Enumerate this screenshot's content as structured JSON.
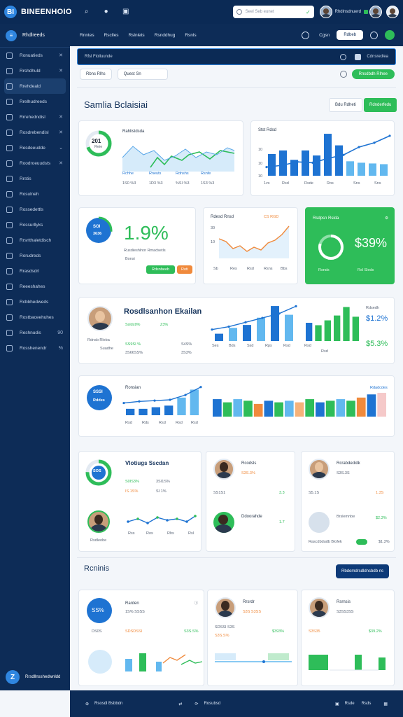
{
  "app": {
    "brand": "BINEENHOIO",
    "logo": "BI"
  },
  "topbar": {
    "search_placeholder": "Seel Seb eunet",
    "user_name": "Rhdlnsdnuerd"
  },
  "sidebar": {
    "title": "Rhdlreeds",
    "items": [
      {
        "label": "Ronuatieds",
        "icon": "grid-icon",
        "x": true
      },
      {
        "label": "Rrshdhuld",
        "icon": "list-icon",
        "x": true
      },
      {
        "label": "Rrehdeald",
        "icon": "home-icon",
        "active": true
      },
      {
        "label": "Rrelhudreeds",
        "icon": "chart-icon"
      },
      {
        "label": "Rrrehedndisl",
        "icon": "doc-icon",
        "x": true
      },
      {
        "label": "Rosdrebendisl",
        "icon": "doc-icon",
        "x": true
      },
      {
        "label": "Resdeeudde",
        "icon": "doc-icon",
        "chev": true
      },
      {
        "label": "Roodroeuudsts",
        "icon": "doc-icon",
        "x": true
      },
      {
        "label": "Rrstis",
        "icon": "bag-icon"
      },
      {
        "label": "Rosulneh",
        "icon": "bag-icon"
      },
      {
        "label": "Rossedettls",
        "icon": "bag-icon"
      },
      {
        "label": "Rossurllyks",
        "icon": "bag-icon"
      },
      {
        "label": "Rrsrtthaletdisch",
        "icon": "bag-icon"
      },
      {
        "label": "Rorudreds",
        "icon": "bag-icon"
      },
      {
        "label": "Rrasdsdrl",
        "icon": "bag-icon"
      },
      {
        "label": "Reeeshahes",
        "icon": "bag-icon"
      },
      {
        "label": "Rcbbhedweds",
        "icon": "bag-icon"
      },
      {
        "label": "Rostbaceehuhes",
        "icon": "bag-icon"
      },
      {
        "label": "Reshnudis",
        "icon": "bag-icon",
        "tag": "90"
      },
      {
        "label": "Rosshenendr",
        "icon": "bag-icon",
        "tag": "%"
      }
    ],
    "footer": "Rrsdllnsshedwnldd"
  },
  "tabs": [
    "Rnntes",
    "Rsclles",
    "Rslnlets",
    "Rsnddhug",
    "Rsnls"
  ],
  "tabbar": {
    "label": "Cgsn",
    "pill": "Rdbeb"
  },
  "subbar": {
    "label": "Rfsl Fiolluunde",
    "right": "Cdnsredlea"
  },
  "filters": [
    "Rbns Rlhs",
    "Quest Sn"
  ],
  "add_button": "Rnsdbdh Rlhee",
  "section": {
    "title": "Samlia Bclaisiai",
    "btn1": "Bdu Rdheti",
    "btn2": "Rdnderfedu"
  },
  "card1": {
    "ring": "201",
    "ring_sub": "Reie",
    "title": "Rahlistdsda",
    "labels": [
      "Rchhe",
      "Rneuts",
      "Rdnshs",
      "Rsnfe"
    ],
    "values": [
      "1S0 %3",
      "1D3 %3",
      "%SI %3",
      "1S3 %3"
    ]
  },
  "card2": {
    "title": "Stst Rdsd",
    "y": [
      "10",
      "10",
      "10"
    ],
    "bars": [
      30,
      35,
      22,
      35,
      28,
      58,
      42,
      20,
      18,
      17,
      16
    ],
    "line": [
      10,
      12,
      16,
      15,
      20,
      24,
      33,
      38,
      46
    ],
    "xlabels": [
      "1vs",
      "Rsd",
      "Rsde",
      "Ros",
      "Sns",
      "Sns"
    ]
  },
  "card3": {
    "ring": "SOI",
    "ring_sub": "3636",
    "big": "1.9%",
    "sub": "Rusdieshlnor Rmadsetls",
    "sub2": "Bonsi",
    "btn": "Rdsnbeeb",
    "btn2": "Roti"
  },
  "card4": {
    "title": "Rdesd Rnsd",
    "tag": "CS RGD",
    "y": [
      "30",
      "10"
    ],
    "line": [
      28,
      24,
      14,
      18,
      10,
      16,
      12,
      22,
      26,
      34,
      46
    ],
    "xlabels": [
      "Sb",
      "Res",
      "Rsd",
      "Rsns",
      "Bbs"
    ]
  },
  "card5": {
    "title": "Rsdpsn Rsida",
    "big": "$39%",
    "sub": "Rsnds",
    "sub2": "Rsl Sleds"
  },
  "card6": {
    "title": "Rosdlsanhon Ekailan",
    "name": "Rdnsb Rleba",
    "date": "Suadhe",
    "v1": "Sslds9%",
    "v2": "Z3%",
    "v3": "SS9SI %",
    "v4": "S4S%",
    "v5": "3S66SS%",
    "v6": "3S3%",
    "line": [
      8,
      12,
      18,
      24,
      30,
      40
    ],
    "bars": [
      10,
      18,
      22,
      32,
      48,
      36
    ],
    "right_label": "Rdsedh",
    "right_big": "$1.2%",
    "right_big2": "$5.3%",
    "xlabels": [
      "Ses",
      "Bds",
      "Ssd",
      "Rps",
      "Rsd",
      "Rsb"
    ],
    "gbars": [
      30,
      26,
      34,
      42,
      56,
      40
    ],
    "gxlabels": [
      "Rsd",
      "Rsd"
    ]
  },
  "card7": {
    "ring": "SSSI",
    "ring_sub": "Rddes",
    "title": "Ronsian",
    "right": "Rdadcdes",
    "line": [
      10,
      12,
      13,
      14,
      20,
      30
    ],
    "bars": [
      8,
      8,
      10,
      12,
      22,
      32
    ],
    "xlabels": [
      "Rsd",
      "Rds",
      "Rsd",
      "Rsd",
      "Rsd"
    ],
    "mbars": [
      22,
      18,
      22,
      20,
      16,
      20,
      18,
      20,
      18,
      22,
      18,
      20,
      22,
      20,
      24,
      28,
      30
    ]
  },
  "card8": {
    "title": "Vlotiugs Sscdan",
    "ring": "SOS",
    "a": "S0IS3%",
    "b": "3SI1S%",
    "c": "IS.1S%",
    "d": "SI 1%",
    "name": "Rsdleobe",
    "xl": [
      "Rss",
      "Ros",
      "Rhs",
      "Rsl"
    ]
  },
  "card9": {
    "title": "Rcodsls",
    "v": "S3S.3%",
    "v2": "SS1S1",
    "v3": "3.3",
    "sub": "Ddoorahde",
    "v4": "1.7"
  },
  "card10": {
    "title": "Rcrabdedidk",
    "v": "S3S.3S",
    "v2": "S5.1S",
    "v3": "1.3S",
    "sub": "Brslemnbe",
    "v4": "$2.3%",
    "sub2": "Rascdbdudb Blofek",
    "v5": "$1.3%"
  },
  "section2": {
    "title": "Rcninis",
    "btn": "Rbdemdrsdldnsbdb  ns"
  },
  "card11": {
    "ring": "SS%",
    "title": "Rarden",
    "v": "1S% SSSS",
    "v2": "DS0S",
    "v3": "SDSDSSI",
    "v4": "S3S.S%"
  },
  "card12": {
    "title": "Rrsrdr",
    "v": "S3S S3SS",
    "v2": "SDSSI S3S",
    "v3": "S3S.S%",
    "v4": "$393%"
  },
  "card13": {
    "title": "Rsrnsis",
    "v": "S3SS3SS",
    "v2": "S3S35",
    "v3": "$39.2%"
  },
  "bottom": {
    "a": "Rsosdl Bsbbdn",
    "b": "Rosubsd",
    "c": "Rsde",
    "d": "Rsds"
  },
  "colors": {
    "navy": "#0d2c57",
    "green": "#2ebd59",
    "blue": "#1e73d2",
    "light": "#62b8ef",
    "orange": "#f08a3c"
  }
}
